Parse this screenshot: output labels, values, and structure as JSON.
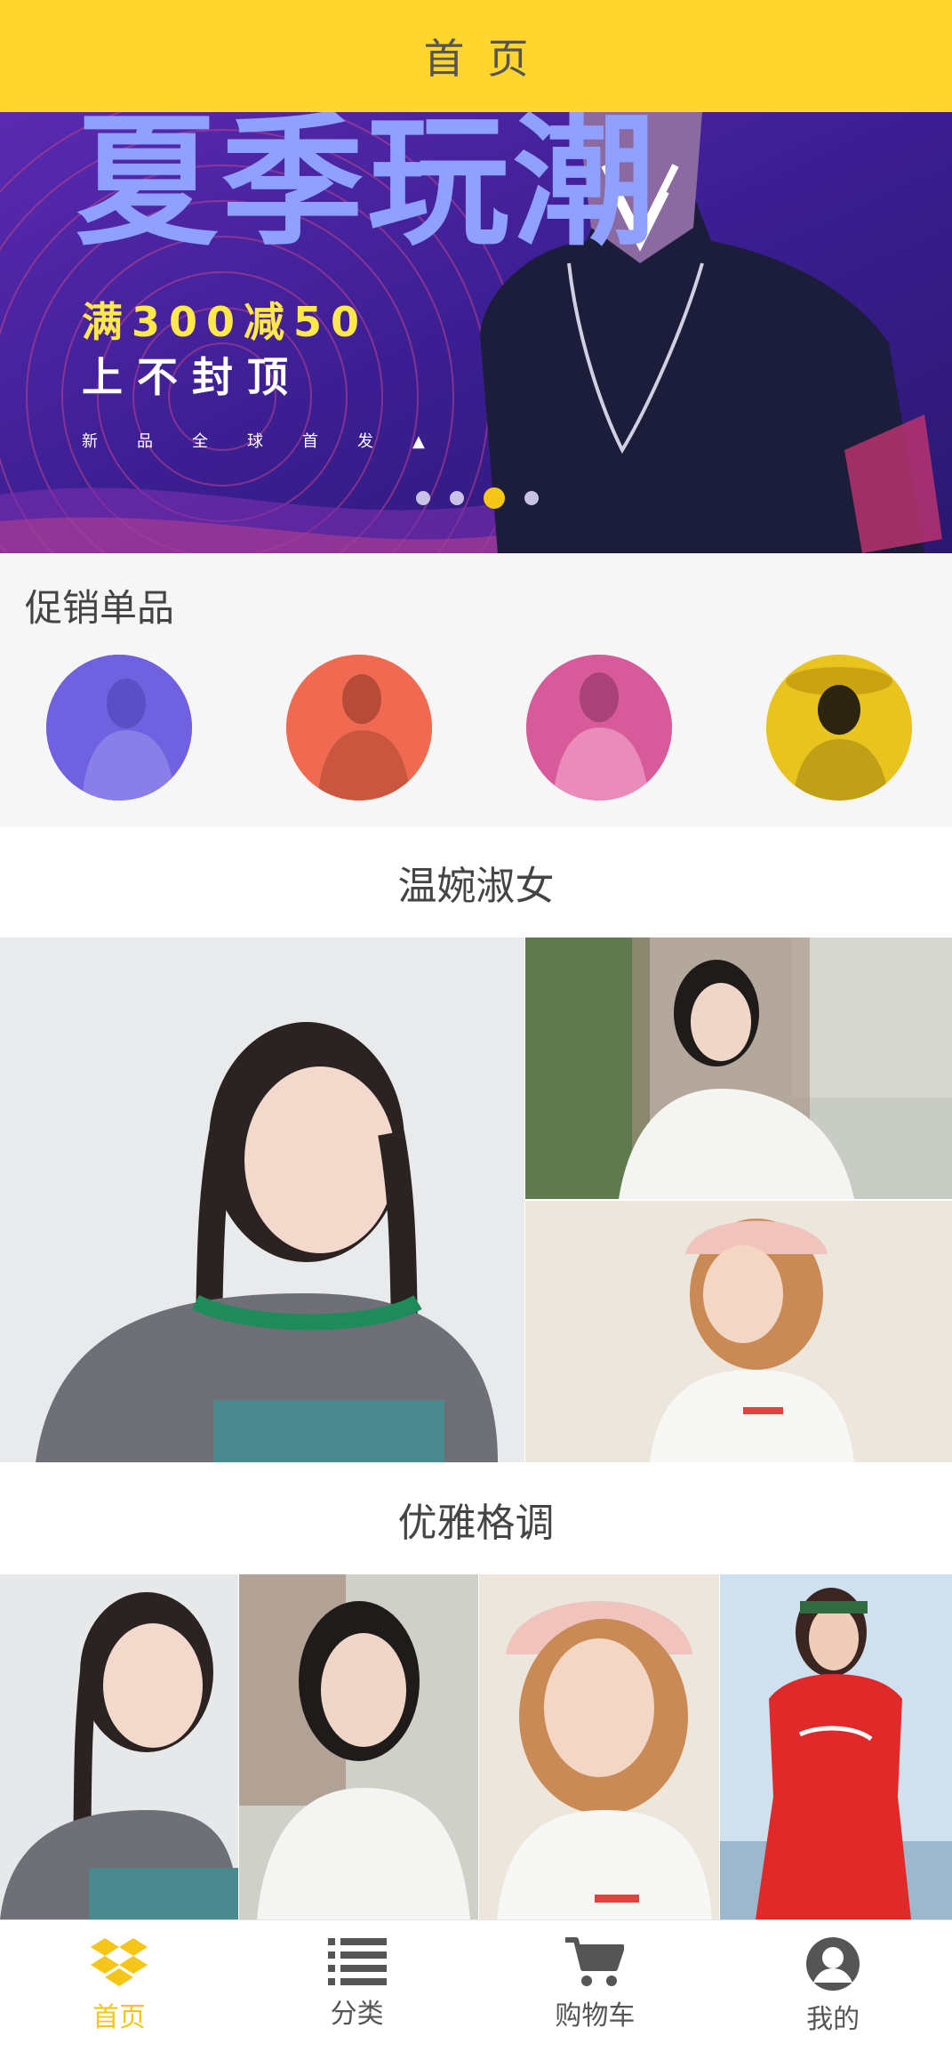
{
  "header": {
    "title": "首页"
  },
  "banner": {
    "headline": "夏季玩潮",
    "offer": "满300减50",
    "subline": "上不封顶",
    "tagline": "新品全球首发▲",
    "slides": 4,
    "active_slide": 3
  },
  "promo": {
    "title": "促销单品",
    "circles": [
      {
        "name": "promo-item-1",
        "color": "#6f61e0"
      },
      {
        "name": "promo-item-2",
        "color": "#ef6a50"
      },
      {
        "name": "promo-item-3",
        "color": "#d75a9a"
      },
      {
        "name": "promo-item-4",
        "color": "#e9c41f"
      }
    ]
  },
  "sections": [
    {
      "title": "温婉淑女"
    },
    {
      "title": "优雅格调"
    }
  ],
  "tabbar": {
    "items": [
      {
        "label": "首页",
        "icon": "dropbox-icon",
        "active": true
      },
      {
        "label": "分类",
        "icon": "list-icon",
        "active": false
      },
      {
        "label": "购物车",
        "icon": "cart-icon",
        "active": false
      },
      {
        "label": "我的",
        "icon": "user-icon",
        "active": false
      }
    ]
  },
  "colors": {
    "brand": "#ffd52e",
    "active_tab": "#f5c518"
  }
}
